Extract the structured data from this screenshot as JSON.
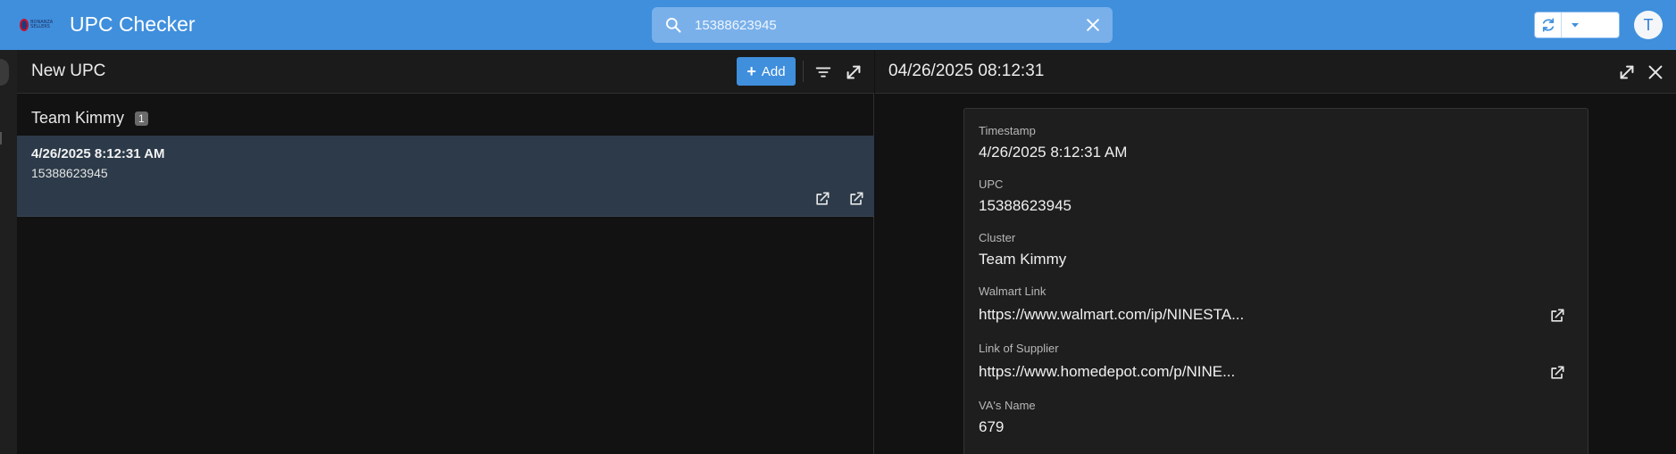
{
  "app": {
    "title": "UPC Checker",
    "logo_text": "BONANZA SELLERS",
    "avatar_letter": "T"
  },
  "search": {
    "value": "15388623945",
    "placeholder": "Search"
  },
  "left_panel": {
    "title": "New UPC",
    "add_label": "Add",
    "group": {
      "name": "Team Kimmy",
      "count": "1"
    },
    "items": [
      {
        "timestamp": "4/26/2025 8:12:31 AM",
        "upc": "15388623945"
      }
    ]
  },
  "right_panel": {
    "title": "04/26/2025 08:12:31",
    "fields": [
      {
        "label": "Timestamp",
        "value": "4/26/2025 8:12:31 AM"
      },
      {
        "label": "UPC",
        "value": "15388623945"
      },
      {
        "label": "Cluster",
        "value": "Team Kimmy"
      },
      {
        "label": "Walmart Link",
        "value": "https://www.walmart.com/ip/NINESTA..."
      },
      {
        "label": "Link of Supplier",
        "value": "https://www.homedepot.com/p/NINE..."
      },
      {
        "label": "VA's Name",
        "value": "679"
      }
    ]
  },
  "icons": {
    "search": "search-icon",
    "clear": "close-icon",
    "sync": "sync-icon",
    "dropdown": "chevron-down-icon",
    "filter": "filter-icon",
    "expand": "expand-icon",
    "external": "external-link-icon",
    "close": "close-icon"
  },
  "colors": {
    "accent": "#3f8fdd",
    "selected_row": "#2c3a49",
    "background": "#121212"
  }
}
